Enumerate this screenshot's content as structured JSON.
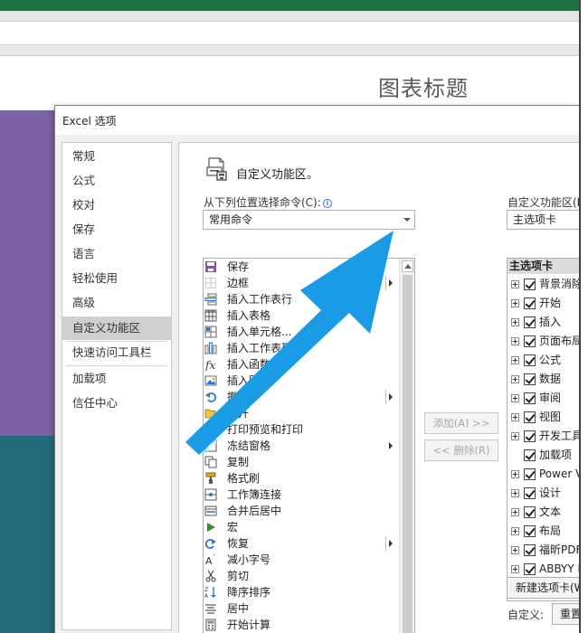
{
  "background": {
    "chart_title": "图表标题",
    "colors": {
      "excel_green": "#1e7145",
      "purple_series": "#7e62a6",
      "teal_series": "#226c7a"
    }
  },
  "dialog": {
    "title": "Excel 选项",
    "nav": [
      {
        "label": "常规"
      },
      {
        "label": "公式"
      },
      {
        "label": "校对"
      },
      {
        "label": "保存"
      },
      {
        "label": "语言"
      },
      {
        "label": "轻松使用"
      },
      {
        "label": "高级"
      },
      {
        "label": "自定义功能区",
        "active": true
      },
      {
        "label": "快速访问工具栏"
      },
      {
        "label": "加载项"
      },
      {
        "label": "信任中心"
      }
    ],
    "header": {
      "title": "自定义功能区。",
      "icon": "customize-ribbon-icon"
    },
    "choose_label": "从下列位置选择命令(C):",
    "choose_value": "常用命令",
    "ribbon_label": "自定义功能区(B):",
    "ribbon_value": "主选项卡",
    "commands": [
      {
        "label": "保存",
        "icon": "save-icon"
      },
      {
        "label": "边框",
        "icon": "border-icon",
        "submenu": true,
        "split": true
      },
      {
        "label": "插入工作表行",
        "icon": "insert-row-icon"
      },
      {
        "label": "插入表格",
        "icon": "table-icon"
      },
      {
        "label": "插入单元格...",
        "icon": "insert-cells-icon"
      },
      {
        "label": "插入工作表列",
        "icon": "insert-column-icon"
      },
      {
        "label": "插入函数...",
        "icon": "function-icon"
      },
      {
        "label": "插入图片",
        "icon": "picture-icon"
      },
      {
        "label": "撤消",
        "icon": "undo-icon",
        "submenu": true,
        "split": true
      },
      {
        "label": "打开",
        "icon": "open-icon"
      },
      {
        "label": "打印预览和打印",
        "icon": "print-preview-icon"
      },
      {
        "label": "冻结窗格",
        "icon": "freeze-panes-icon",
        "submenu": true
      },
      {
        "label": "复制",
        "icon": "copy-icon"
      },
      {
        "label": "格式刷",
        "icon": "format-painter-icon"
      },
      {
        "label": "工作簿连接",
        "icon": "connections-icon"
      },
      {
        "label": "合并后居中",
        "icon": "merge-center-icon"
      },
      {
        "label": "宏",
        "icon": "macro-icon"
      },
      {
        "label": "恢复",
        "icon": "redo-icon",
        "submenu": true,
        "split": true
      },
      {
        "label": "减小字号",
        "icon": "decrease-font-icon"
      },
      {
        "label": "剪切",
        "icon": "cut-icon"
      },
      {
        "label": "降序排序",
        "icon": "sort-descending-icon"
      },
      {
        "label": "居中",
        "icon": "align-center-icon"
      },
      {
        "label": "开始计算",
        "icon": "calculate-icon"
      }
    ],
    "add_button": "添加(A) >>",
    "remove_button": "<< 删除(R)",
    "tree_header": "主选项卡",
    "tabs": [
      {
        "label": "背景消除",
        "expand": true
      },
      {
        "label": "开始",
        "expand": true
      },
      {
        "label": "插入",
        "expand": true
      },
      {
        "label": "页面布局",
        "expand": true
      },
      {
        "label": "公式",
        "expand": true
      },
      {
        "label": "数据",
        "expand": true
      },
      {
        "label": "审阅",
        "expand": true
      },
      {
        "label": "视图",
        "expand": true
      },
      {
        "label": "开发工具",
        "expand": true
      },
      {
        "label": "加载项",
        "expand": false
      },
      {
        "label": "Power View",
        "expand": true
      },
      {
        "label": "设计",
        "expand": true
      },
      {
        "label": "文本",
        "expand": true
      },
      {
        "label": "布局",
        "expand": true
      },
      {
        "label": "福昕PDF",
        "expand": true
      },
      {
        "label": "ABBYY FineReader",
        "expand": true
      }
    ],
    "new_tab_button": "新建选项卡(W)",
    "customize_label": "自定义:",
    "reset_button": "重置(E)"
  },
  "annotation": {
    "arrow_color": "#1a9be6"
  }
}
